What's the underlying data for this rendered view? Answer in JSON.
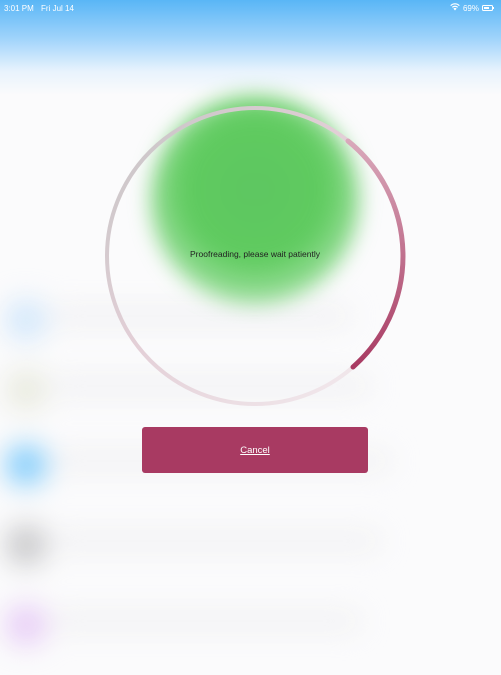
{
  "status_bar": {
    "time": "3:01 PM",
    "date": "Fri Jul 14",
    "wifi_icon": "wifi-icon",
    "battery_percent": "69%",
    "battery_level": 0.69
  },
  "progress": {
    "message": "Proofreading, please wait patiently",
    "ring_color": "#a83a62"
  },
  "cancel_button": {
    "label": "Cancel",
    "color": "#a83a62"
  }
}
